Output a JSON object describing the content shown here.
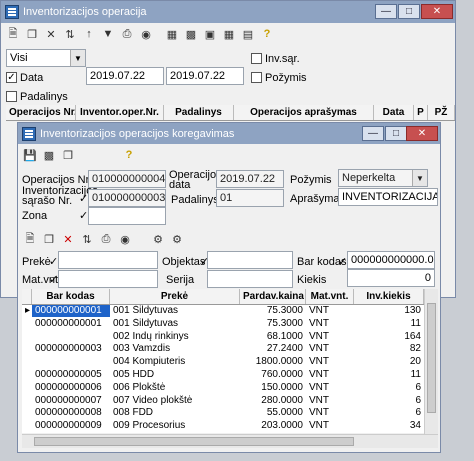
{
  "outer": {
    "title": "Inventorizacijos operacija",
    "filter_select": "Visi",
    "data_label": "Data",
    "date_from": "2019.07.22",
    "date_to": "2019.07.22",
    "inv_sar_label": "Inv.sąr.",
    "pozymis_label": "Požymis",
    "padalinys_label": "Padalinys",
    "columns": [
      "Operacijos Nr.",
      "Inventor.oper.Nr.",
      "Padalinys",
      "Operacijos aprašymas",
      "Data",
      "P",
      "PŽ"
    ]
  },
  "inner": {
    "title": "Inventorizacijos operacijos koregavimas",
    "oper_nr_label": "Operacijos Nr.",
    "oper_nr": "010000000004",
    "oper_data_label": "Operacijos data",
    "oper_data": "2019.07.22",
    "pozymis_label": "Požymis",
    "pozymis": "Neperkelta",
    "inv_sar_label": "Inventorizacijos sąrašo Nr.",
    "inv_sar": "010000000003",
    "padalinys_label": "Padalinys",
    "padalinys": "01",
    "aprasymas_label": "Aprašymas",
    "aprasymas": "INVENTORIZACIJA",
    "zona_label": "Zona",
    "preke_label": "Prekė",
    "objektas_label": "Objektas",
    "bar_kodas_label": "Bar kodas",
    "bar_kodas": "000000000000.0",
    "mat_vnt_label": "Mat.vnt.",
    "serija_label": "Serija",
    "kiekis_label": "Kiekis",
    "kiekis": "0",
    "columns": [
      "Bar kodas",
      "Prekė",
      "Pardav.kaina",
      "Mat.vnt.",
      "Inv.kiekis"
    ],
    "rows": [
      {
        "bar": "000000000001",
        "preke": "001  Šildytuvas",
        "kaina": "75.3000",
        "vnt": "VNT",
        "kiekis": "130"
      },
      {
        "bar": "000000000001",
        "preke": "001  Šildytuvas",
        "kaina": "75.3000",
        "vnt": "VNT",
        "kiekis": "11"
      },
      {
        "bar": "",
        "preke": "002  Indų rinkinys",
        "kaina": "68.1000",
        "vnt": "VNT",
        "kiekis": "164"
      },
      {
        "bar": "000000000003",
        "preke": "003  Vamzdis",
        "kaina": "27.2400",
        "vnt": "VNT",
        "kiekis": "82"
      },
      {
        "bar": "",
        "preke": "004  Kompiuteris",
        "kaina": "1800.0000",
        "vnt": "VNT",
        "kiekis": "20"
      },
      {
        "bar": "000000000005",
        "preke": "005  HDD",
        "kaina": "760.0000",
        "vnt": "VNT",
        "kiekis": "11"
      },
      {
        "bar": "000000000006",
        "preke": "006  Plokštė",
        "kaina": "150.0000",
        "vnt": "VNT",
        "kiekis": "6"
      },
      {
        "bar": "000000000007",
        "preke": "007  Video plokštė",
        "kaina": "280.0000",
        "vnt": "VNT",
        "kiekis": "6"
      },
      {
        "bar": "000000000008",
        "preke": "008  FDD",
        "kaina": "55.0000",
        "vnt": "VNT",
        "kiekis": "6"
      },
      {
        "bar": "000000000009",
        "preke": "009  Procesorius",
        "kaina": "203.0000",
        "vnt": "VNT",
        "kiekis": "34"
      }
    ]
  }
}
